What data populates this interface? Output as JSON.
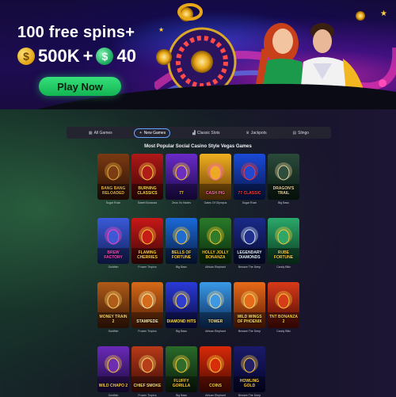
{
  "hero": {
    "headline": "100 free spins+",
    "gold_amount": "500K",
    "plus": "+",
    "sweeps_amount": "40",
    "gold_coin_symbol": "$",
    "sweeps_coin_symbol": "$",
    "cta_label": "Play Now",
    "colors": {
      "cta": "#22c862",
      "gold_coin": "#f2b620",
      "sweeps_coin": "#1fb865"
    }
  },
  "tabs": [
    {
      "label": "All Games",
      "icon": "grid-icon",
      "glyph": "▦",
      "active": false
    },
    {
      "label": "New Games",
      "icon": "star-icon",
      "glyph": "✦",
      "active": true
    },
    {
      "label": "Classic Slots",
      "icon": "slot-machine-icon",
      "glyph": "▟",
      "active": false
    },
    {
      "label": "Jackpots",
      "icon": "trophy-icon",
      "glyph": "♛",
      "active": false
    },
    {
      "label": "Slingo",
      "icon": "slingo-icon",
      "glyph": "▤",
      "active": false
    }
  ],
  "section_title": "Most Popular Social Casino Style Vegas Games",
  "games": [
    {
      "title": "BANG BANG RELOADED",
      "caption": "Sugar Rush",
      "bg": [
        "#7a3a12",
        "#2b0f05"
      ],
      "accent": "#e8b040"
    },
    {
      "title": "BURNING CLASSICS",
      "caption": "Sweet Bonanza",
      "bg": [
        "#b01818",
        "#3a0505"
      ],
      "accent": "#ffd24a"
    },
    {
      "title": "77",
      "caption": "Zeus Vs Hades",
      "bg": [
        "#6a2ac8",
        "#1a0a4a"
      ],
      "accent": "#ffcf3a"
    },
    {
      "title": "CASH PIG",
      "caption": "Gates Of Olympus",
      "bg": [
        "#f0b020",
        "#6a3a06"
      ],
      "accent": "#ff6fa8"
    },
    {
      "title": "77 CLASSIC",
      "caption": "Sugar Rush",
      "bg": [
        "#1a4ad8",
        "#07164a"
      ],
      "accent": "#ff3a3a"
    },
    {
      "title": "DRAGON'S TRAIL",
      "caption": "Big Bass",
      "bg": [
        "#2a4a3a",
        "#0a1a12"
      ],
      "accent": "#e8d8a0"
    },
    {
      "title": "BREW FACTORY",
      "caption": "Goldfish",
      "bg": [
        "#3a5ad8",
        "#12205a"
      ],
      "accent": "#ff4ac8"
    },
    {
      "title": "FLAMING CHERRIES",
      "caption": "Frozen Tropics",
      "bg": [
        "#c81818",
        "#3a0606"
      ],
      "accent": "#ffd040"
    },
    {
      "title": "BELLS OF FORTUNE",
      "caption": "Big Bass",
      "bg": [
        "#1a6ad8",
        "#081a40"
      ],
      "accent": "#ffd040"
    },
    {
      "title": "HOLLY JOLLY BONANZA",
      "caption": "African Elephant",
      "bg": [
        "#2a7a2a",
        "#0a2a0a"
      ],
      "accent": "#ffcc30"
    },
    {
      "title": "LEGENDARY DIAMONDS",
      "caption": "Beware The Deep",
      "bg": [
        "#1a2a8a",
        "#080c30"
      ],
      "accent": "#e0f0ff"
    },
    {
      "title": "RUBE FORTUNE",
      "caption": "Candy Blitz",
      "bg": [
        "#2aa86a",
        "#0a3a20"
      ],
      "accent": "#ffd040"
    },
    {
      "title": "MONEY TRAIN 2",
      "caption": "Goldfish",
      "bg": [
        "#b05a18",
        "#3a1805"
      ],
      "accent": "#ffd870"
    },
    {
      "title": "STAMPEDE",
      "caption": "Frozen Tropics",
      "bg": [
        "#d86a18",
        "#4a1a05"
      ],
      "accent": "#fff0b0"
    },
    {
      "title": "DIAMOND HITS",
      "caption": "Big Bass",
      "bg": [
        "#2a3ad8",
        "#0a0a40"
      ],
      "accent": "#ffe050"
    },
    {
      "title": "TOWER",
      "caption": "African Elephant",
      "bg": [
        "#3a9ae8",
        "#0a2a5a"
      ],
      "accent": "#f0e0a0"
    },
    {
      "title": "WILD WINGS OF PHOENIX",
      "caption": "Beware The Deep",
      "bg": [
        "#e86a18",
        "#5a1a05"
      ],
      "accent": "#ffe070"
    },
    {
      "title": "TNT BONANZA 2",
      "caption": "Candy Blitz",
      "bg": [
        "#d83a18",
        "#4a0a05"
      ],
      "accent": "#ffd040"
    },
    {
      "title": "WILD CHAPO 2",
      "caption": "Goldfish",
      "bg": [
        "#6a2ab8",
        "#1a0a3a"
      ],
      "accent": "#ffd040"
    },
    {
      "title": "CHIEF SMOKE",
      "caption": "Frozen Tropics",
      "bg": [
        "#b83a18",
        "#3a0a05"
      ],
      "accent": "#ffe070"
    },
    {
      "title": "FLUFFY GORILLA",
      "caption": "Big Bass",
      "bg": [
        "#2a6a2a",
        "#0a1a0a"
      ],
      "accent": "#ffd040"
    },
    {
      "title": "COINS",
      "caption": "African Elephant",
      "bg": [
        "#d82a08",
        "#4a0a02"
      ],
      "accent": "#ffd040"
    },
    {
      "title": "HOWLING GOLD",
      "caption": "Beware The Deep",
      "bg": [
        "#1a1a6a",
        "#05052a"
      ],
      "accent": "#ffd040"
    }
  ]
}
